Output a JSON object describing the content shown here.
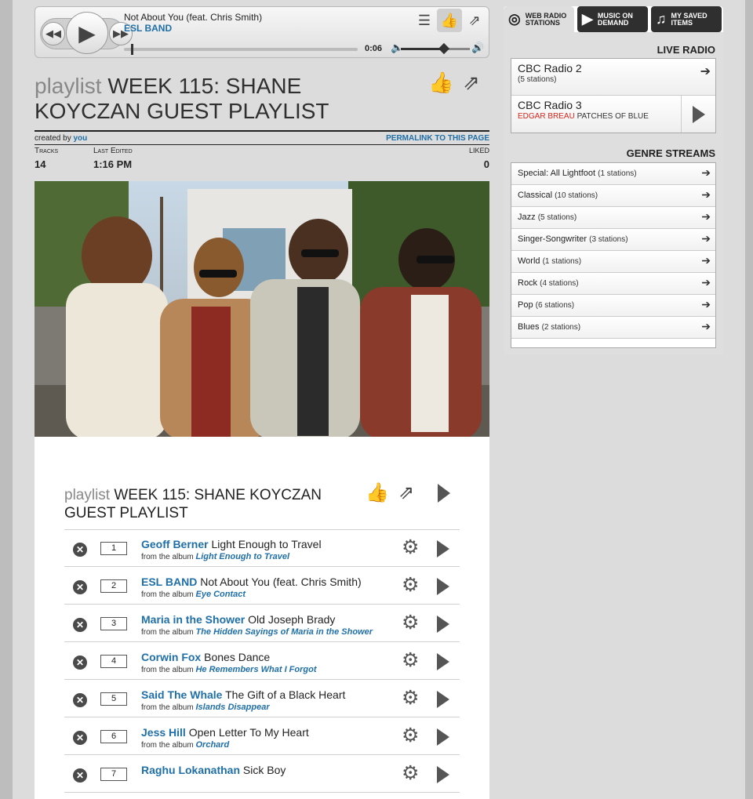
{
  "player": {
    "track_title": "Not About You (feat. Chris Smith)",
    "artist": "ESL BAND",
    "time": "0:06",
    "progress_fraction": 0.03,
    "volume_fraction": 0.62
  },
  "playlist": {
    "prefix": "playlist",
    "title": "WEEK 115: SHANE KOYCZAN GUEST PLAYLIST",
    "created_by_label": "created by",
    "created_by": "you",
    "permalink": "PERMALINK TO THIS PAGE",
    "tracks_label": "Tracks",
    "tracks": "14",
    "last_edited_label": "Last Edited",
    "last_edited": "1:16 PM",
    "liked_label": "LIKED",
    "liked": "0"
  },
  "tracklist": [
    {
      "num": "1",
      "artist": "Geoff Berner",
      "title": "Light Enough to Travel",
      "album_prefix": "from the album",
      "album": "Light Enough to Travel"
    },
    {
      "num": "2",
      "artist": "ESL BAND",
      "title": "Not About You (feat. Chris Smith)",
      "album_prefix": "from the album",
      "album": "Eye Contact"
    },
    {
      "num": "3",
      "artist": "Maria in the Shower",
      "title": "Old Joseph Brady",
      "album_prefix": "from the album",
      "album": "The Hidden Sayings of Maria in the Shower"
    },
    {
      "num": "4",
      "artist": "Corwin Fox",
      "title": "Bones Dance",
      "album_prefix": "from the album",
      "album": "He Remembers What I Forgot"
    },
    {
      "num": "5",
      "artist": "Said The Whale",
      "title": "The Gift of a Black Heart",
      "album_prefix": "from the album",
      "album": "Islands Disappear"
    },
    {
      "num": "6",
      "artist": "Jess Hill",
      "title": "Open Letter To My Heart",
      "album_prefix": "from the album",
      "album": "Orchard"
    },
    {
      "num": "7",
      "artist": "Raghu Lokanathan",
      "title": "Sick Boy",
      "album_prefix": "",
      "album": ""
    }
  ],
  "sidebar": {
    "tabs": [
      {
        "line1": "WEB RADIO",
        "line2": "STATIONS"
      },
      {
        "line1": "MUSIC ON",
        "line2": "DEMAND"
      },
      {
        "line1": "MY SAVED",
        "line2": "ITEMS"
      }
    ],
    "live_radio_heading": "LIVE RADIO",
    "stations": [
      {
        "name": "CBC Radio 2",
        "sub": "(5 stations)"
      },
      {
        "name": "CBC Radio 3",
        "now_artist": "EDGAR BREAU",
        "now_title": "PATCHES OF BLUE"
      }
    ],
    "genre_heading": "GENRE STREAMS",
    "genres": [
      {
        "name": "Special: All Lightfoot",
        "count": "(1 stations)"
      },
      {
        "name": "Classical",
        "count": "(10 stations)"
      },
      {
        "name": "Jazz",
        "count": "(5 stations)"
      },
      {
        "name": "Singer-Songwriter",
        "count": "(3 stations)"
      },
      {
        "name": "World",
        "count": "(1 stations)"
      },
      {
        "name": "Rock",
        "count": "(4 stations)"
      },
      {
        "name": "Pop",
        "count": "(6 stations)"
      },
      {
        "name": "Blues",
        "count": "(2 stations)"
      }
    ]
  }
}
